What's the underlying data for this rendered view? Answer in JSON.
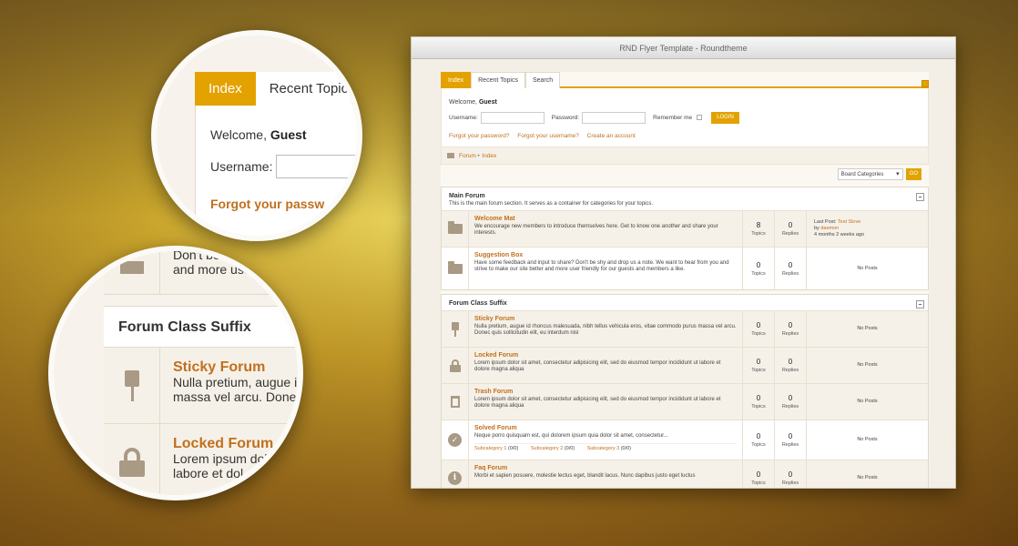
{
  "window": {
    "title": "RND Flyer Template - Roundtheme"
  },
  "tabs": [
    {
      "label": "Index",
      "active": true
    },
    {
      "label": "Recent Topics",
      "active": false
    },
    {
      "label": "Search",
      "active": false
    }
  ],
  "login": {
    "welcome_prefix": "Welcome,",
    "welcome_user": "Guest",
    "username_label": "Username:",
    "password_label": "Password:",
    "remember_label": "Remember me",
    "login_button": "LOGIN",
    "forgot_password": "Forgot your password?",
    "forgot_username": "Forgot your username?",
    "create_account": "Create an account"
  },
  "breadcrumb": {
    "forum": "Forum",
    "index": "Index",
    "separator": "▸"
  },
  "category_select": {
    "value": "Board Categories",
    "go": "GO"
  },
  "sections": [
    {
      "title": "Main Forum",
      "desc": "This is the main forum section. It serves as a container for categories for your topics.",
      "forums": [
        {
          "icon": "folder-icon",
          "title": "Welcome Mat",
          "desc": "We encourage new members to introduce themselves here. Get to know one another and share your interests.",
          "topics": "8",
          "replies": "0",
          "last_label": "Last Post:",
          "last_link": "Test Slove",
          "by_label": "by",
          "by_user": "daemon",
          "ago": "4 months 2 weeks ago"
        },
        {
          "icon": "folder-icon",
          "title": "Suggestion Box",
          "desc": "Have some feedback and input to share? Don't be shy and drop us a note. We want to hear from you and strive to make our site better and more user friendly for our guests and members a like.",
          "topics": "0",
          "replies": "0",
          "no_posts": "No Posts"
        }
      ]
    },
    {
      "title": "Forum Class Suffix",
      "forums": [
        {
          "icon": "pin-icon",
          "title": "Sticky Forum",
          "desc": "Nulla pretium, augue id rhoncus malesuada, nibh tellus vehicula eros, vitae commodo purus massa vel arcu. Donec quis sollicitudin elit, eu interdum nisl",
          "topics": "0",
          "replies": "0",
          "no_posts": "No Posts"
        },
        {
          "icon": "lock-icon",
          "title": "Locked Forum",
          "desc": "Lorem ipsum dolor sit amet, consectetur adipisicing elit, sed do eiusmod tempor incididunt ut labore et dolore magna aliqua",
          "topics": "0",
          "replies": "0",
          "no_posts": "No Posts"
        },
        {
          "icon": "trash-icon",
          "title": "Trash Forum",
          "desc": "Lorem ipsum dolor sit amet, consectetur adipisicing elit, sed do eiusmod tempor incididunt ut labore et dolore magna aliqua",
          "topics": "0",
          "replies": "0",
          "no_posts": "No Posts"
        },
        {
          "icon": "check-icon",
          "title": "Solved Forum",
          "desc": "Neque porro quisquam est, qui dolorem ipsum quia dolor sit amet, consectetur...",
          "subs": [
            {
              "name": "Subcategory 1",
              "count": "(0/0)"
            },
            {
              "name": "Subcategory 2",
              "count": "(0/0)"
            },
            {
              "name": "Subcategory 3",
              "count": "(0/0)"
            }
          ],
          "topics": "0",
          "replies": "0",
          "no_posts": "No Posts"
        },
        {
          "icon": "info-icon",
          "title": "Faq Forum",
          "desc": "Morbi et sapien posuere, molestie lectus eget, blandit lacus. Nunc dapibus justo eget luctus",
          "topics": "0",
          "replies": "0",
          "no_posts": "No Posts"
        }
      ]
    }
  ],
  "stat_labels": {
    "topics": "Topics",
    "replies": "Replies"
  },
  "zoom1": {
    "tab_index": "Index",
    "tab_recent": "Recent Topic",
    "welcome_prefix": "Welcome,",
    "welcome_user": "Guest",
    "username_label": "Username:",
    "forgot": "Forgot your passw"
  },
  "zoom2": {
    "top_text_1": "Don't be s",
    "top_text_2": "and more use",
    "section_title": "Forum Class Suffix",
    "sticky_title": "Sticky Forum",
    "sticky_desc_1": "Nulla pretium, augue i",
    "sticky_desc_2": "massa vel arcu. Done",
    "locked_title": "Locked Forum",
    "locked_desc_1": "Lorem ipsum dol",
    "locked_desc_2": "labore et dol"
  },
  "colors": {
    "accent": "#e3a200",
    "link": "#c0701f",
    "icon": "#a89a84"
  }
}
